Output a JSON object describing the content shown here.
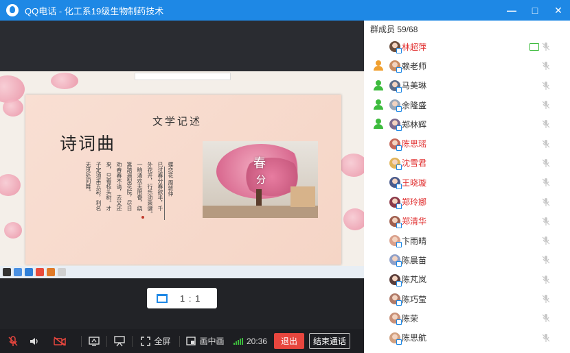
{
  "window": {
    "title": "QQ电话 - 化工系19级生物制药技术",
    "buttons": {
      "minimize": "—",
      "maximize": "□",
      "close": "✕"
    }
  },
  "shared_screen": {
    "slide_heading": "文学记述",
    "slide_title": "诗词曲",
    "poem_columns": [
      "蝶恋花  周敦仲",
      "已过春分春欲半，千",
      "外花开，行乐须乘健。",
      "一晌清欢无限眷，绕",
      "篱踏遍梨花院，尽日",
      "劝春春不语，去又还",
      "来，只看枝头树。才",
      "子定须采五彩，利名",
      "无觅处问舞。"
    ],
    "photo_text_1": "春",
    "photo_text_2": "分"
  },
  "ratio_button": {
    "label": "1 : 1"
  },
  "toolbar": {
    "fullscreen_label": "全屏",
    "pip_label": "画中画",
    "time": "20:36",
    "exit_label": "退出",
    "end_label": "结束通话"
  },
  "members": {
    "header": "群成员 59/68",
    "list": [
      {
        "name": "林超萍",
        "color": "#e02c2c",
        "role": "",
        "sharing": true
      },
      {
        "name": "赖老师",
        "color": "#333333",
        "role": "admin-orange",
        "sharing": false
      },
      {
        "name": "马美琳",
        "color": "#333333",
        "role": "admin-green",
        "sharing": false
      },
      {
        "name": "余隆盛",
        "color": "#333333",
        "role": "admin-green",
        "sharing": false
      },
      {
        "name": "郑林辉",
        "color": "#333333",
        "role": "admin-green",
        "sharing": false
      },
      {
        "name": "陈思瑶",
        "color": "#e02c2c",
        "role": "",
        "sharing": false
      },
      {
        "name": "沈雪君",
        "color": "#e02c2c",
        "role": "",
        "sharing": false
      },
      {
        "name": "王晓璇",
        "color": "#e02c2c",
        "role": "",
        "sharing": false
      },
      {
        "name": "郑玲娜",
        "color": "#e02c2c",
        "role": "",
        "sharing": false
      },
      {
        "name": "郑清华",
        "color": "#e02c2c",
        "role": "",
        "sharing": false
      },
      {
        "name": "卞雨晴",
        "color": "#333333",
        "role": "",
        "sharing": false
      },
      {
        "name": "陈晨苗",
        "color": "#333333",
        "role": "",
        "sharing": false
      },
      {
        "name": "陈芃岚",
        "color": "#333333",
        "role": "",
        "sharing": false
      },
      {
        "name": "陈巧莹",
        "color": "#333333",
        "role": "",
        "sharing": false
      },
      {
        "name": "陈荣",
        "color": "#333333",
        "role": "",
        "sharing": false
      },
      {
        "name": "陈思航",
        "color": "#333333",
        "role": "",
        "sharing": false
      }
    ]
  },
  "colors": {
    "accent": "#1e88e5",
    "exit": "#e8463e",
    "signal": "#3dbb3d"
  }
}
